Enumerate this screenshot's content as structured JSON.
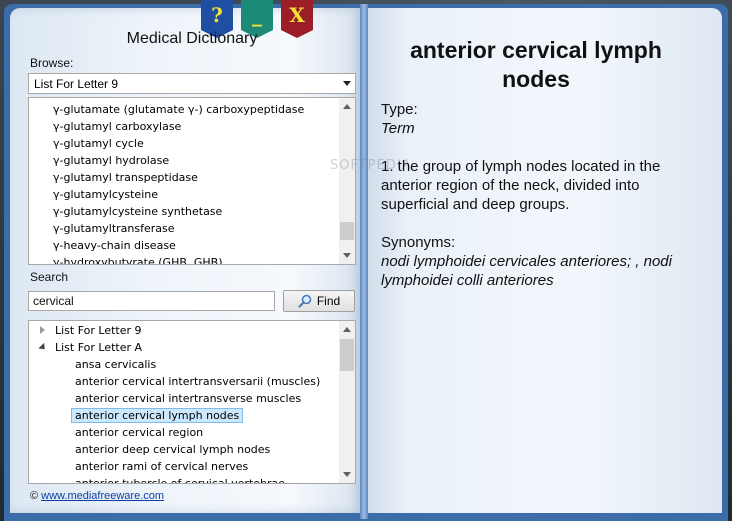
{
  "app": {
    "title": "Medical Dictionary",
    "ribbons": {
      "help": "?",
      "minimize": "_",
      "close": "X"
    }
  },
  "browse": {
    "label": "Browse:",
    "selected": "List For Letter 9",
    "items": [
      "γ-glutamate (glutamate γ-) carboxypeptidase",
      "γ-glutamyl carboxylase",
      "γ-glutamyl cycle",
      "γ-glutamyl hydrolase",
      "γ-glutamyl transpeptidase",
      "γ-glutamylcysteine",
      "γ-glutamylcysteine synthetase",
      "γ-glutamyltransferase",
      "γ-heavy-chain disease",
      "γ-hydroxybutyrate (GHB, GHB)"
    ]
  },
  "search": {
    "label": "Search",
    "value": "cervical",
    "find_label": "Find"
  },
  "results": {
    "groups": [
      {
        "label": "List For Letter 9",
        "expanded": false
      },
      {
        "label": "List For Letter A",
        "expanded": true
      }
    ],
    "items": [
      "ansa cervicalis",
      "anterior cervical intertransversarii (muscles)",
      "anterior cervical intertransverse muscles",
      "anterior cervical lymph nodes",
      "anterior cervical region",
      "anterior deep cervical lymph nodes",
      "anterior rami of cervical nerves",
      "anterior tubercle of cervical vertebrae"
    ],
    "selected": "anterior cervical lymph nodes"
  },
  "footer": {
    "copyright": "©",
    "link": "www.mediafreeware.com"
  },
  "entry": {
    "title": "anterior cervical lymph nodes",
    "type_label": "Type:",
    "type_value": "Term",
    "definition": "1. the group of lymph nodes located in the anterior region of the neck, divided into superficial and deep groups.",
    "synonyms_label": "Synonyms:",
    "synonyms_value": "nodi lymphoidei cervicales anteriores; , nodi lymphoidei colli anteriores"
  },
  "watermark": "SOFTPEDIA"
}
